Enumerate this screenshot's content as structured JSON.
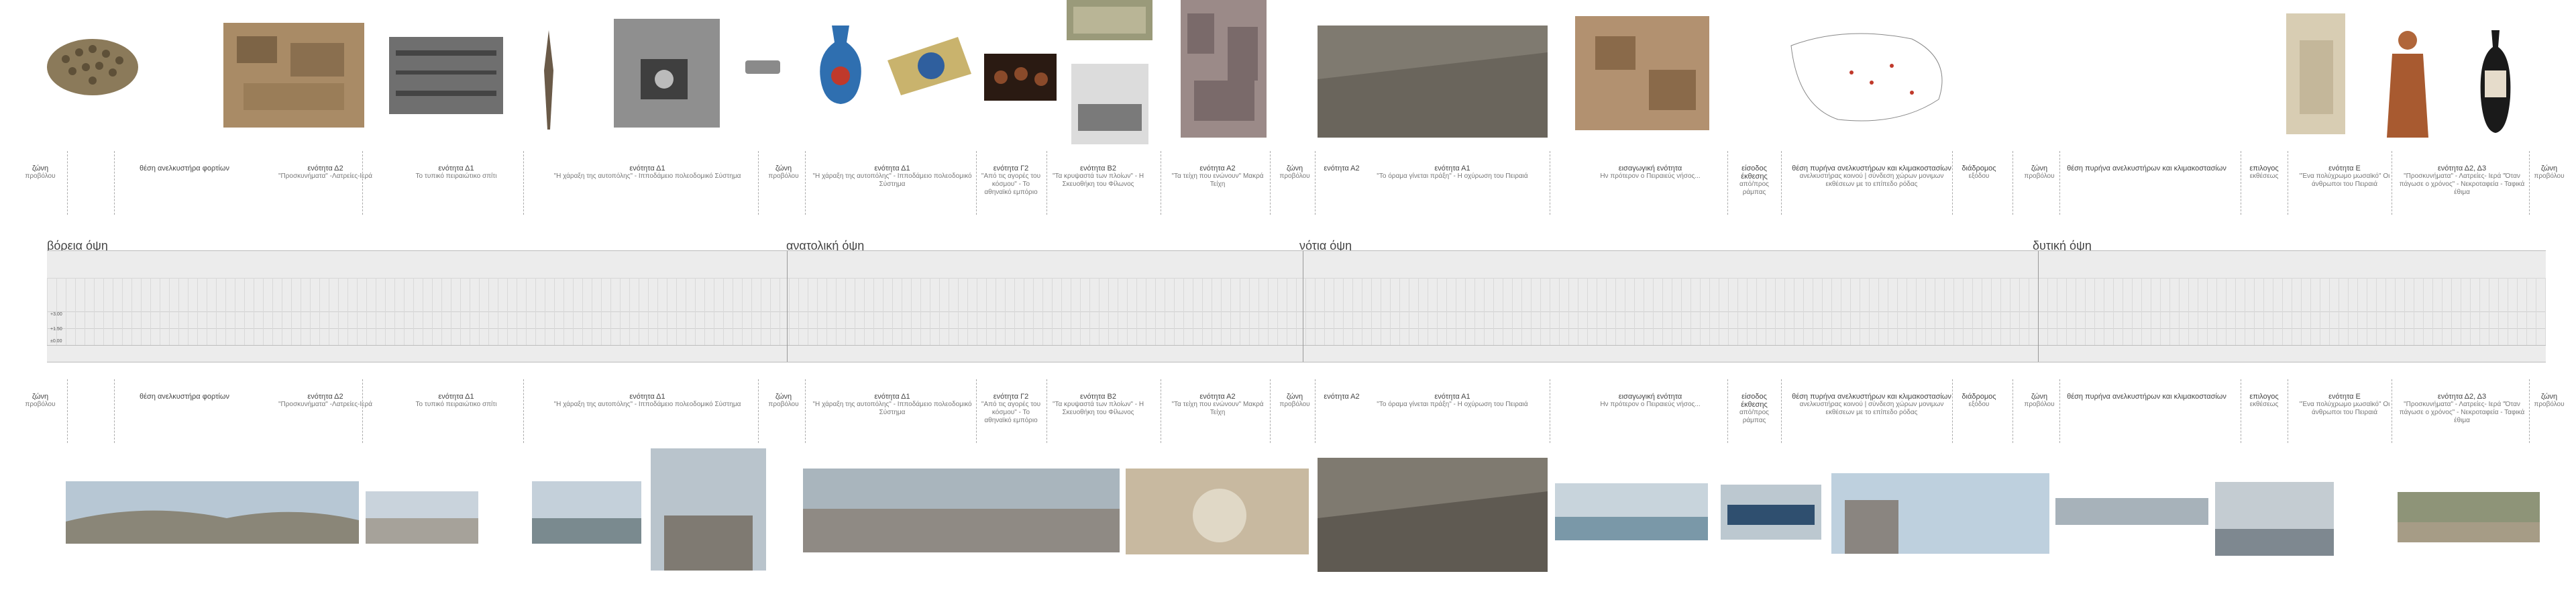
{
  "facades": [
    {
      "id": "f1",
      "label": "βόρεια όψη"
    },
    {
      "id": "f2",
      "label": "ανατολική όψη"
    },
    {
      "id": "f3",
      "label": "νότια όψη"
    },
    {
      "id": "f4",
      "label": "δυτική όψη"
    }
  ],
  "levels": [
    "+3.00",
    "+1.50",
    "±0.00"
  ],
  "segments": [
    {
      "title": "ζώνη",
      "subtitle": "προβόλου"
    },
    {
      "title": "θέση ανελκυστήρα φορτίων",
      "subtitle": ""
    },
    {
      "title": "ενότητα Δ2",
      "subtitle": "\"Προσκυνήματα\" -Λατρείες-Ιερά"
    },
    {
      "title": "ενότητα Δ1",
      "subtitle": "Το τυπικό πειραιώτικο σπίτι"
    },
    {
      "title": "ενότητα Δ1",
      "subtitle": "\"Η χάραξη της αυτοπόλης\" - Ιπποδάμειο πολεοδομικό Σύστημα"
    },
    {
      "title": "ζώνη",
      "subtitle": "προβόλου"
    },
    {
      "title": "ενότητα Δ1",
      "subtitle": "\"Η χάραξη της αυτοπόλης\" - Ιπποδάμειο πολεοδομικό Σύστημα"
    },
    {
      "title": "ενότητα Γ2",
      "subtitle": "\"Από τις αγορές του κόσμου\" - Το αθηναϊκό εμπόριο"
    },
    {
      "title": "ενότητα Β2",
      "subtitle": "\"Τα κρυψαστά των πλοίων\" - Η Σκευοθήκη του Φίλωνος"
    },
    {
      "title": "ενότητα Α2",
      "subtitle": "\"Τα τείχη που ενώνουν\" Μακρά Τείχη"
    },
    {
      "title": "ζώνη",
      "subtitle": "προβόλου"
    },
    {
      "title": "ενότητα Α2",
      "subtitle": ""
    },
    {
      "title": "ενότητα Α1",
      "subtitle": "\"Το όραμα γίνεται πράξη\" - Η οχύρωση του Πειραιά"
    },
    {
      "title": "εισαγωγική ενότητα",
      "subtitle": "Ην πρότερον ο Πειραιεύς νήσος..."
    },
    {
      "title": "είσοδος έκθεσης",
      "subtitle": "από/προς ράμπας"
    },
    {
      "title": "θέση πυρήνα ανελκυστήρων και κλιμακοστασίων",
      "subtitle": "ανελκυστήρας κοινού | σύνδεση χώρων μονιμων εκθέσεων με το επίπεδο ρόδας"
    },
    {
      "title": "διάδρομος",
      "subtitle": "εξόδου"
    },
    {
      "title": "ζώνη",
      "subtitle": "προβόλου"
    },
    {
      "title": "θέση πυρήνα ανελκυστήρων και κλιμακοστασίων",
      "subtitle": ""
    },
    {
      "title": "επιλογος",
      "subtitle": "εκθέσεως"
    },
    {
      "title": "ενότητα Ε",
      "subtitle": "\"Ένα πολύχρωμο μωσαϊκό\" Οι άνθρωποι του Πειραιά"
    },
    {
      "title": "ενότητα Δ2, Δ3",
      "subtitle": "\"Προσκυνήματα\" - Λατρείες- Ιερά \"Όταν πάγωσε ο χρόνος\" - Νεκροταφεία - Ταφικά έθιμα"
    },
    {
      "title": "ζώνη",
      "subtitle": "προβόλου"
    }
  ],
  "top_images": [
    {
      "name": "pottery-heap"
    },
    {
      "name": "excavation-site"
    },
    {
      "name": "ruins-photo-bw"
    },
    {
      "name": "spear-point"
    },
    {
      "name": "excavation-bw"
    },
    {
      "name": "small-object"
    },
    {
      "name": "ceramic-jug"
    },
    {
      "name": "painted-plate"
    },
    {
      "name": "food-items"
    },
    {
      "name": "stone-block"
    },
    {
      "name": "ruins-bw-small"
    },
    {
      "name": "ruins-aerial"
    },
    {
      "name": "wall-remains-panorama"
    },
    {
      "name": "excavation-trench"
    },
    {
      "name": "city-map"
    },
    {
      "name": "relief-sculpture"
    },
    {
      "name": "figurine"
    },
    {
      "name": "lekythos-vase"
    }
  ],
  "bottom_images": [
    {
      "name": "hills-panorama"
    },
    {
      "name": "town-view"
    },
    {
      "name": "coastal-view"
    },
    {
      "name": "city-tower-view"
    },
    {
      "name": "port-aerial"
    },
    {
      "name": "ruins-dome"
    },
    {
      "name": "wall-remains-bottom"
    },
    {
      "name": "harbor-view"
    },
    {
      "name": "ferry-view"
    },
    {
      "name": "industrial-building"
    },
    {
      "name": "sea-strip"
    },
    {
      "name": "port-cranes"
    },
    {
      "name": "garden-ruins"
    }
  ]
}
